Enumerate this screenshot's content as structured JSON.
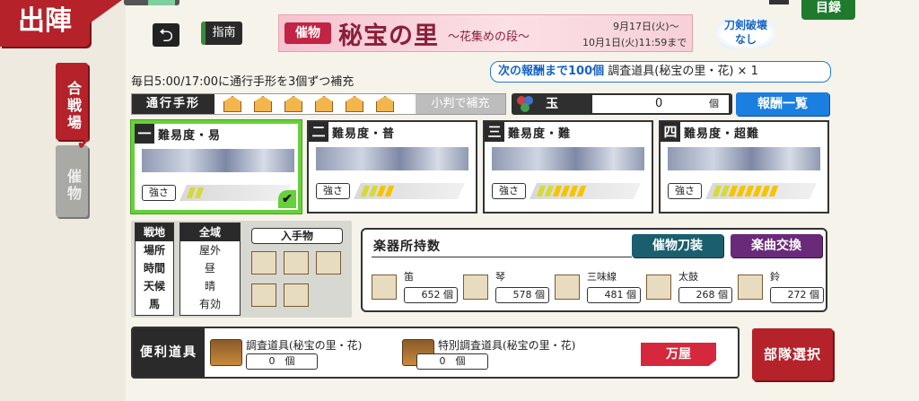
{
  "header": {
    "kanji": "出陣",
    "catalog": "目録",
    "back_icon": "back-arrow-icon",
    "guide": "指南"
  },
  "side_tabs": [
    {
      "label": "合戦場",
      "selected": false
    },
    {
      "label": "催物",
      "selected": true
    }
  ],
  "banner": {
    "tag": "催物",
    "title": "秘宝の里",
    "subtitle": "〜花集めの段〜",
    "date_start": "9月17日(火)〜",
    "date_end": "10月1日(火)11:59まで"
  },
  "no_break_badge": "刀剣破壊なし",
  "info": {
    "daily": "毎日5:00/17:00に通行手形を3個ずつ補充",
    "reward_next": "次の報酬まで100個",
    "reward_item": "調査道具(秘宝の里・花) × 1"
  },
  "pass": {
    "label": "通行手形",
    "count": 6,
    "refill_button": "小判で補充"
  },
  "gem": {
    "label": "玉",
    "value": "0",
    "unit": "個"
  },
  "reward_list_button": "報酬一覧",
  "difficulties": [
    {
      "num": "一",
      "title": "難易度・易",
      "strength_label": "強さ",
      "level": 2,
      "selected": true
    },
    {
      "num": "二",
      "title": "難易度・普",
      "strength_label": "強さ",
      "level": 4,
      "selected": false
    },
    {
      "num": "三",
      "title": "難易度・難",
      "strength_label": "強さ",
      "level": 6,
      "selected": false
    },
    {
      "num": "四",
      "title": "難易度・超難",
      "strength_label": "強さ",
      "level": 8,
      "selected": false
    }
  ],
  "colors": {
    "bar_low": "#d6d93a",
    "bar_high": "#f5c400",
    "accent_red": "#b5222a"
  },
  "field": {
    "keys": [
      "戦地",
      "場所",
      "時間",
      "天候",
      "馬"
    ],
    "values": [
      "全域",
      "屋外",
      "昼",
      "晴",
      "有効"
    ],
    "drops_label": "入手物"
  },
  "instruments": {
    "title": "楽器所持数",
    "treasure_button": "催物刀装",
    "music_button": "楽曲交換",
    "items": [
      {
        "name": "笛",
        "count": "652",
        "unit": "個"
      },
      {
        "name": "琴",
        "count": "578",
        "unit": "個"
      },
      {
        "name": "三味線",
        "count": "481",
        "unit": "個"
      },
      {
        "name": "太鼓",
        "count": "268",
        "unit": "個"
      },
      {
        "name": "鈴",
        "count": "272",
        "unit": "個"
      }
    ]
  },
  "tools": {
    "label": "便利道具",
    "items": [
      {
        "name": "調査道具(秘宝の里・花)",
        "count": "0",
        "unit": "個"
      },
      {
        "name": "特別調査道具(秘宝の里・花)",
        "count": "0",
        "unit": "個"
      }
    ],
    "shop_button": "万屋"
  },
  "unit_select_button": "部隊選択"
}
